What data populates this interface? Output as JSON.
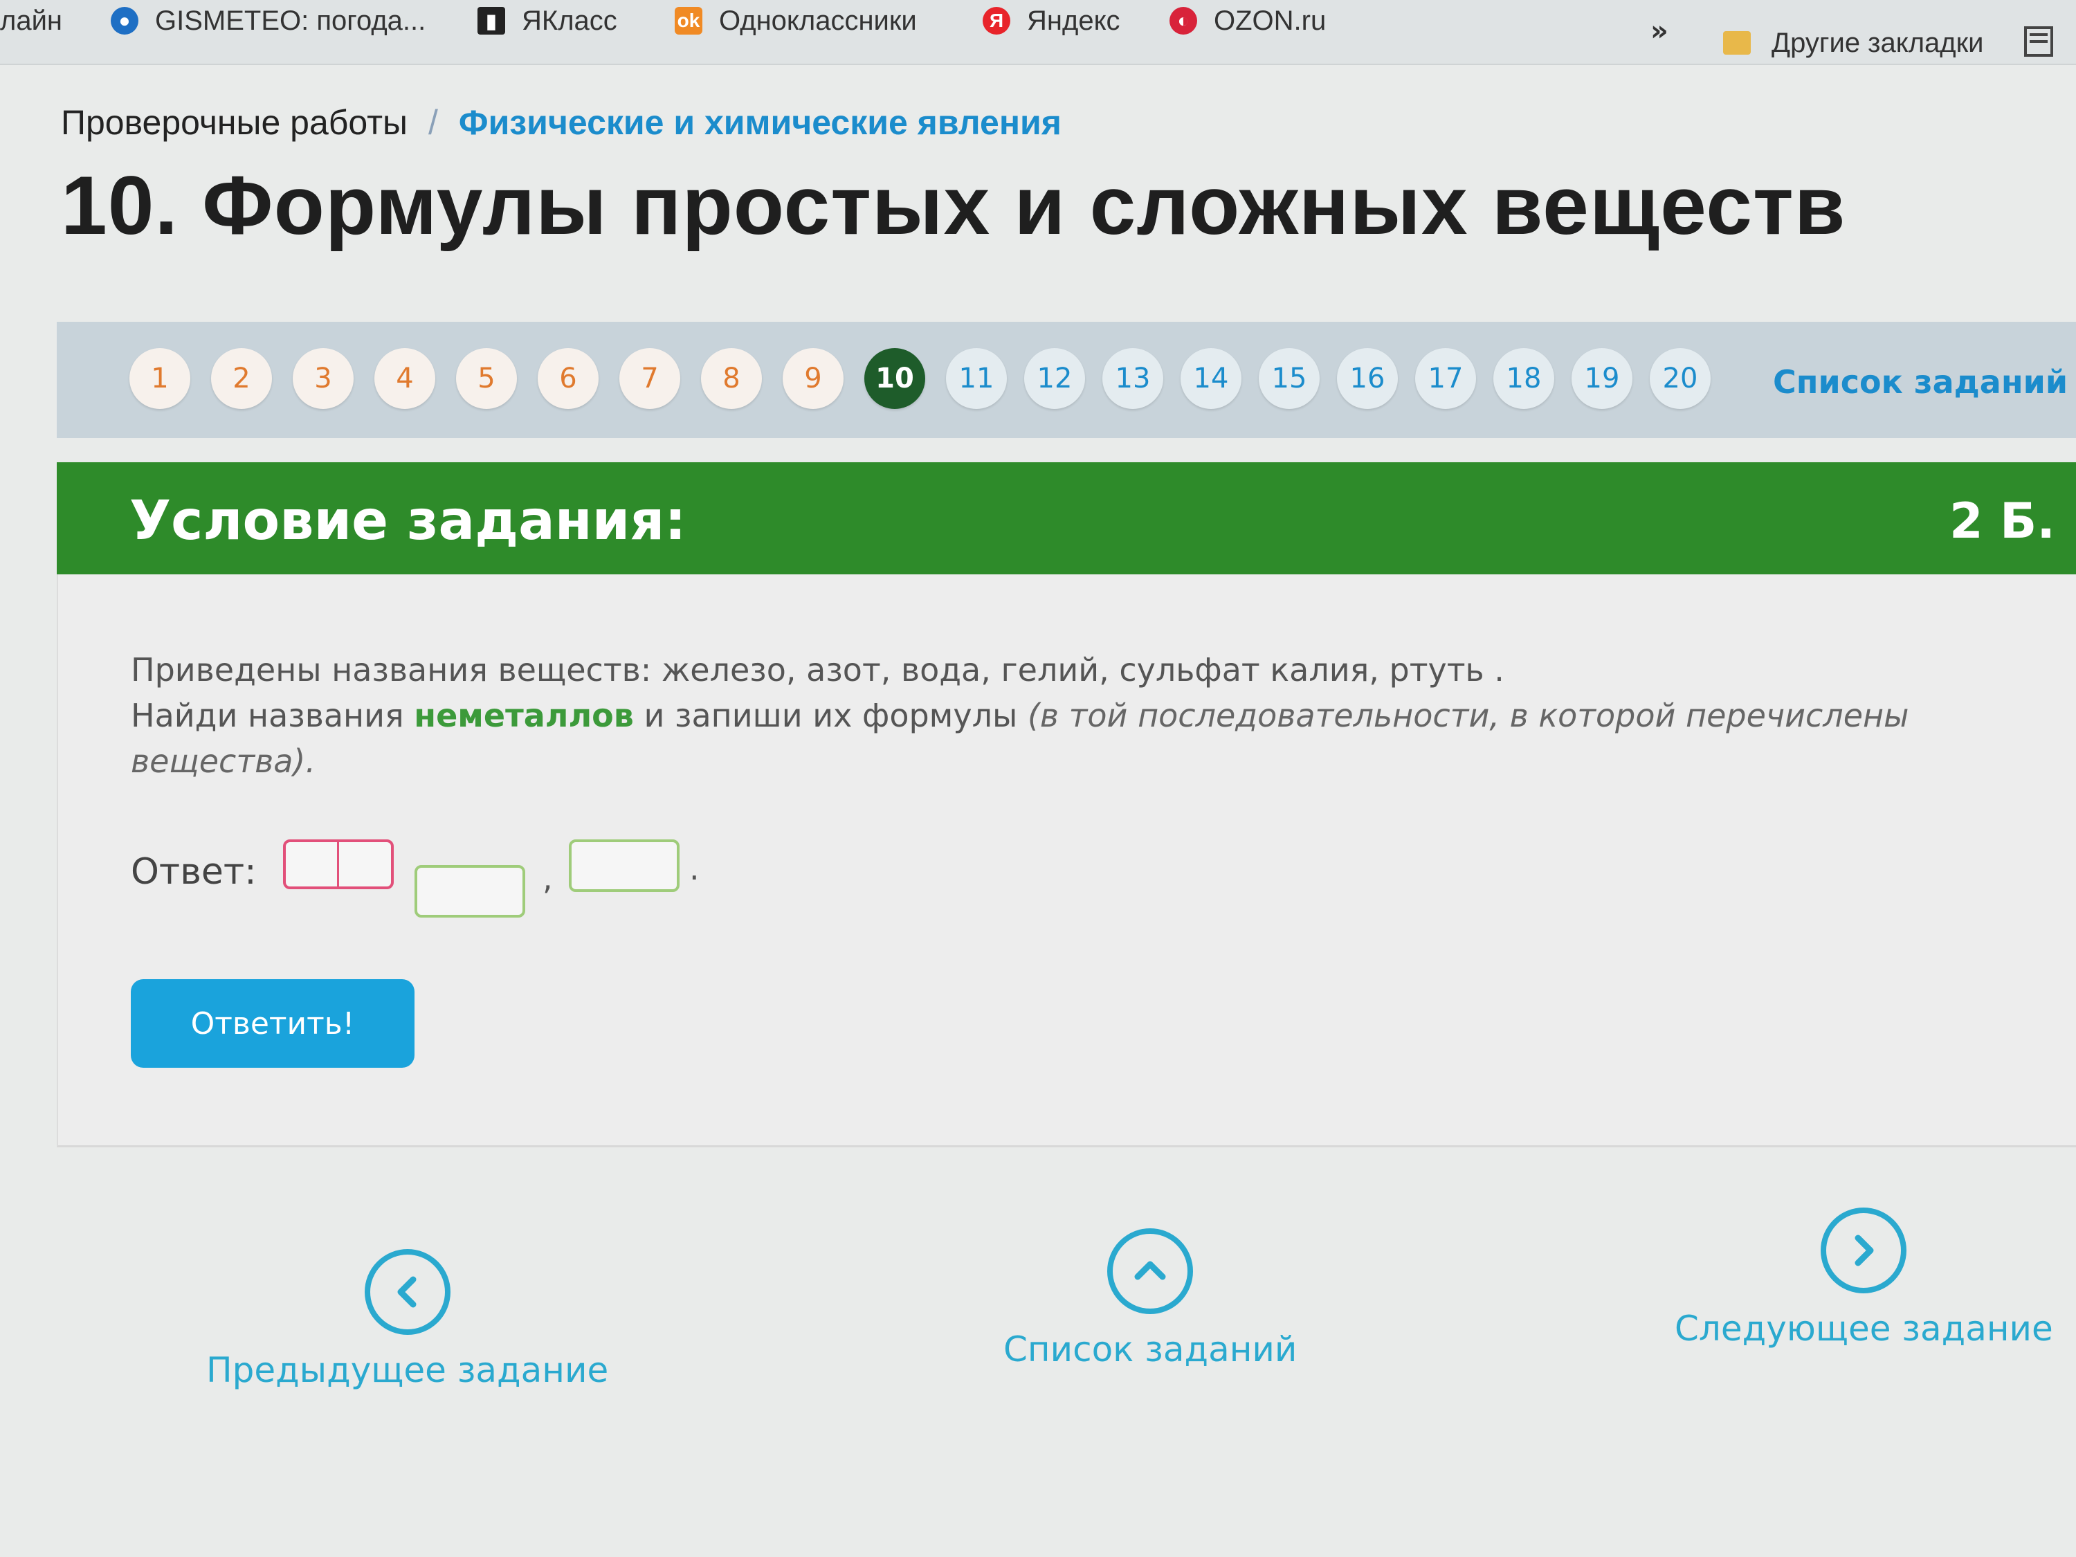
{
  "bookmarks": {
    "items": [
      {
        "label": "лайн",
        "icon": "none"
      },
      {
        "label": "GISMETEO: погода...",
        "icon": "gismeteo-icon"
      },
      {
        "label": "ЯКласс",
        "icon": "yaklass-icon"
      },
      {
        "label": "Одноклассники",
        "icon": "odnoklassniki-icon"
      },
      {
        "label": "Яндекс",
        "icon": "yandex-icon"
      },
      {
        "label": "OZON.ru",
        "icon": "ozon-icon"
      }
    ],
    "overflow": "»",
    "other": "Другие закладки"
  },
  "breadcrumb": {
    "parent": "Проверочные работы",
    "separator": "/",
    "current": "Физические и химические явления"
  },
  "page_title": "10. Формулы простых и сложных веществ",
  "task_nav": {
    "numbers": [
      "1",
      "2",
      "3",
      "4",
      "5",
      "6",
      "7",
      "8",
      "9",
      "10",
      "11",
      "12",
      "13",
      "14",
      "15",
      "16",
      "17",
      "18",
      "19",
      "20"
    ],
    "active": "10",
    "list_link": "Список заданий"
  },
  "condition": {
    "title": "Условие задания:",
    "points": "2 Б."
  },
  "task": {
    "line1": "Приведены названия веществ: железо, азот, вода, гелий, сульфат калия, ртуть .",
    "line2_a": "Найди названия ",
    "line2_highlight": "неметаллов",
    "line2_b": " и запиши их формулы ",
    "line2_italic": "(в той последовательности, в которой перечислены вещества)."
  },
  "answer": {
    "label": "Ответ:",
    "comma": ",",
    "dot": ".",
    "submit": "Ответить!"
  },
  "bottom_nav": {
    "prev": "Предыдущее задание",
    "list": "Список заданий",
    "next": "Следующее задание"
  },
  "colors": {
    "accent_blue": "#1b8ccc",
    "green_header": "#2e8b2a",
    "active_number": "#1e5c2a",
    "submit_blue": "#1aa3dc",
    "error_pink": "#e2507a"
  }
}
